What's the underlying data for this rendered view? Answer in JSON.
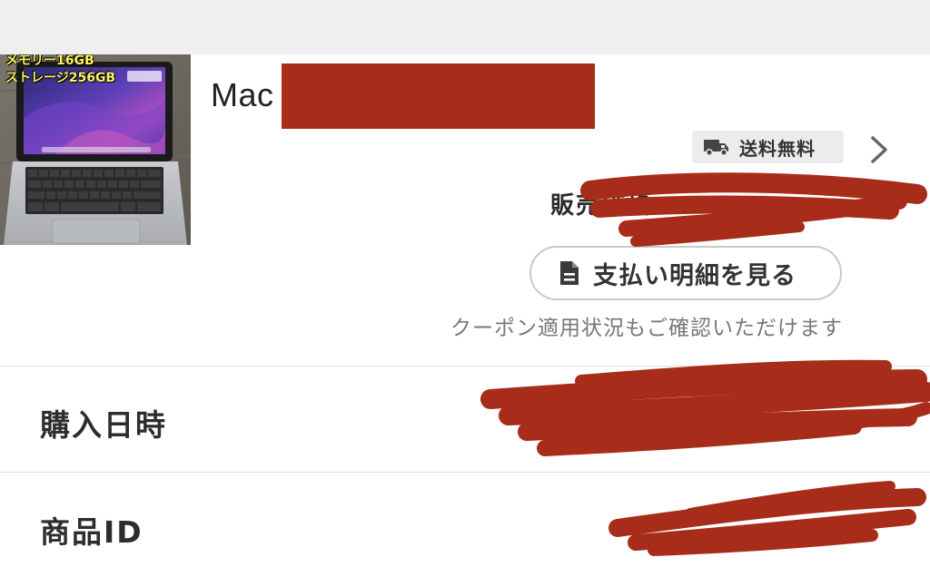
{
  "product": {
    "thumbnail_overlay": [
      "メモリー16GB",
      "ストレージ256GB"
    ],
    "title_prefix": "Mac",
    "shipping_badge_label": "送料無料",
    "price_label": "販売価格",
    "payment_details_button": "支払い明細を見る",
    "coupon_note": "クーポン適用状況もご確認いただけます"
  },
  "details": [
    {
      "label": "購入日時",
      "value": ""
    },
    {
      "label": "商品ID",
      "value": ""
    }
  ],
  "icons": {
    "shipping": "truck-icon",
    "navigate": "chevron-right-icon",
    "payment_details": "document-icon"
  },
  "colors": {
    "redaction": "#a72c1a",
    "badge_background": "#ececec",
    "top_bar": "#efefef",
    "text_primary": "#2d2d2d",
    "text_secondary": "#777777",
    "overlay_text": "#fff45a"
  }
}
